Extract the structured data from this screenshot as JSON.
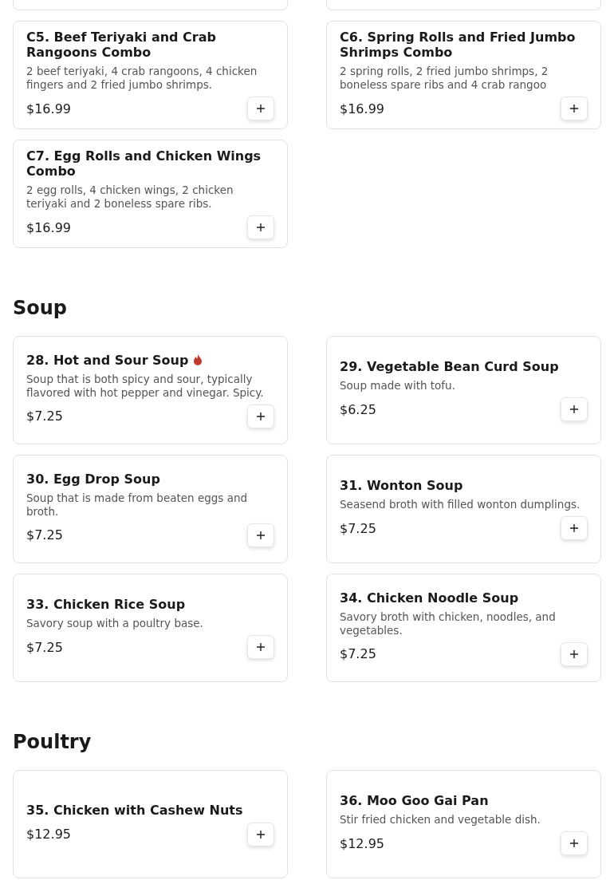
{
  "sections": [
    {
      "items": [
        {
          "name": "C5. Beef Teriyaki and Crab Rangoons Combo",
          "description": "2 beef teriyaki, 4 crab rangoons, 4 chicken fingers and 2 fried jumbo shrimps.",
          "price": "$16.99",
          "spicy": false
        },
        {
          "name": "C6. Spring Rolls and Fried Jumbo Shrimps Combo",
          "description": "2 spring rolls, 2 fried jumbo shrimps, 2 boneless spare ribs and 4 crab rangoo",
          "price": "$16.99",
          "spicy": false
        },
        {
          "name": "C7. Egg Rolls and Chicken Wings Combo",
          "description": "2 egg rolls, 4 chicken wings, 2 chicken teriyaki and 2 boneless spare ribs.",
          "price": "$16.99",
          "spicy": false
        }
      ]
    },
    {
      "title": "Soup",
      "items": [
        {
          "name": "28. Hot and Sour Soup",
          "description": "Soup that is both spicy and sour, typically flavored with hot pepper and vinegar. Spicy.",
          "price": "$7.25",
          "spicy": true
        },
        {
          "name": "29. Vegetable Bean Curd Soup",
          "description": "Soup made with tofu.",
          "price": "$6.25",
          "spicy": false
        },
        {
          "name": "30. Egg Drop Soup",
          "description": "Soup that is made from beaten eggs and broth.",
          "price": "$7.25",
          "spicy": false
        },
        {
          "name": "31. Wonton Soup",
          "description": "Seasend broth with filled wonton dumplings.",
          "price": "$7.25",
          "spicy": false
        },
        {
          "name": "33. Chicken Rice Soup",
          "description": "Savory soup with a poultry base.",
          "price": "$7.25",
          "spicy": false
        },
        {
          "name": "34. Chicken Noodle Soup",
          "description": "Savory broth with chicken, noodles, and vegetables.",
          "price": "$7.25",
          "spicy": false
        }
      ]
    },
    {
      "title": "Poultry",
      "items": [
        {
          "name": "35. Chicken with Cashew Nuts",
          "price": "$12.95",
          "spicy": false
        },
        {
          "name": "36. Moo Goo Gai Pan",
          "description": "Stir fried chicken and vegetable dish.",
          "price": "$12.95",
          "spicy": false
        }
      ]
    }
  ]
}
